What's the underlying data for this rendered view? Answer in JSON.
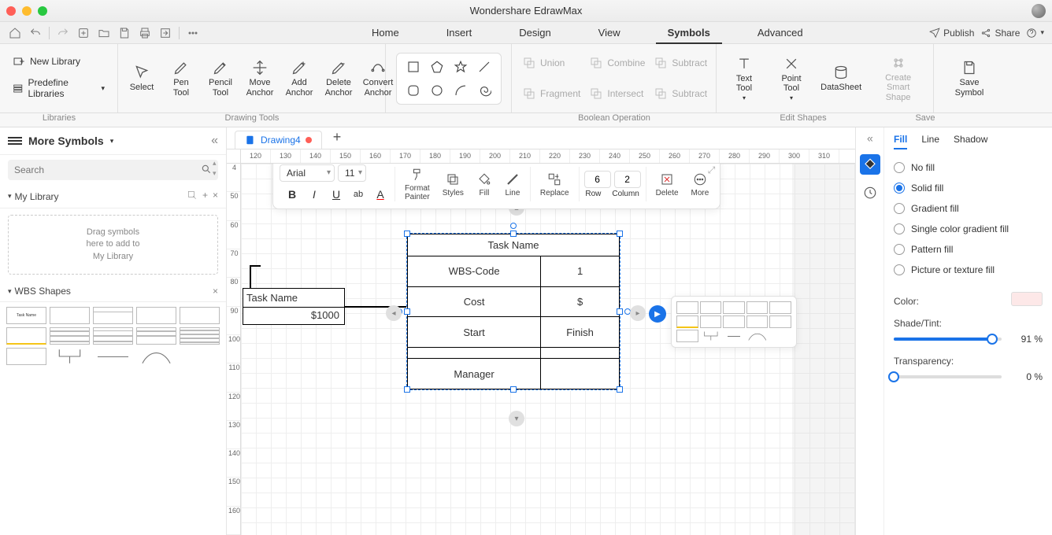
{
  "app": {
    "title": "Wondershare EdrawMax"
  },
  "topbar": {
    "menus": [
      "Home",
      "Insert",
      "Design",
      "View",
      "Symbols",
      "Advanced"
    ],
    "active_menu": "Symbols",
    "publish": "Publish",
    "share": "Share"
  },
  "ribbon": {
    "libraries": {
      "new_library": "New Library",
      "predefine": "Predefine Libraries",
      "caption": "Libraries"
    },
    "drawing": {
      "select": "Select",
      "pen": "Pen\nTool",
      "pencil": "Pencil\nTool",
      "move_anchor": "Move\nAnchor",
      "add_anchor": "Add\nAnchor",
      "delete_anchor": "Delete\nAnchor",
      "convert_anchor": "Convert\nAnchor",
      "caption": "Drawing Tools"
    },
    "boolean": {
      "union": "Union",
      "combine": "Combine",
      "subtract1": "Subtract",
      "fragment": "Fragment",
      "intersect": "Intersect",
      "subtract2": "Subtract",
      "caption": "Boolean Operation"
    },
    "edit": {
      "text_tool": "Text\nTool",
      "point_tool": "Point\nTool",
      "datasheet": "DataSheet",
      "create_smart": "Create Smart\nShape",
      "caption": "Edit Shapes"
    },
    "save": {
      "save_symbol": "Save\nSymbol",
      "caption": "Save"
    }
  },
  "left": {
    "title": "More Symbols",
    "search_placeholder": "Search",
    "mylib": "My Library",
    "drop_hint": "Drag symbols\nhere to add to\nMy Library",
    "wbs": "WBS Shapes"
  },
  "doc": {
    "name": "Drawing4"
  },
  "ruler_h": [
    "120",
    "130",
    "140",
    "150",
    "160",
    "170",
    "180",
    "190",
    "200",
    "210",
    "220",
    "230",
    "240",
    "250",
    "260",
    "270",
    "280",
    "290",
    "300",
    "310"
  ],
  "ruler_v": [
    "4",
    "50",
    "60",
    "70",
    "80",
    "90",
    "100",
    "110",
    "120",
    "130",
    "140",
    "150",
    "160"
  ],
  "float_tb": {
    "font": "Arial",
    "size": "11",
    "format_painter": "Format\nPainter",
    "styles": "Styles",
    "fill": "Fill",
    "line": "Line",
    "replace": "Replace",
    "row_val": "6",
    "col_val": "2",
    "row": "Row",
    "column": "Column",
    "delete": "Delete",
    "more": "More"
  },
  "canvas": {
    "small_task": {
      "name": "Task Name",
      "cost": "$1000"
    },
    "table": {
      "title": "Task Name",
      "rows": [
        [
          "WBS-Code",
          "1"
        ],
        [
          "Cost",
          "$"
        ],
        [
          "Start",
          "Finish"
        ],
        [
          "",
          ""
        ],
        [
          "Manager",
          ""
        ]
      ]
    }
  },
  "right": {
    "tabs": [
      "Fill",
      "Line",
      "Shadow"
    ],
    "active_tab": "Fill",
    "options": [
      "No fill",
      "Solid fill",
      "Gradient fill",
      "Single color gradient fill",
      "Pattern fill",
      "Picture or texture fill"
    ],
    "selected_option": "Solid fill",
    "color_label": "Color:",
    "shade_label": "Shade/Tint:",
    "shade_value": "91 %",
    "transparency_label": "Transparency:",
    "transparency_value": "0 %"
  }
}
